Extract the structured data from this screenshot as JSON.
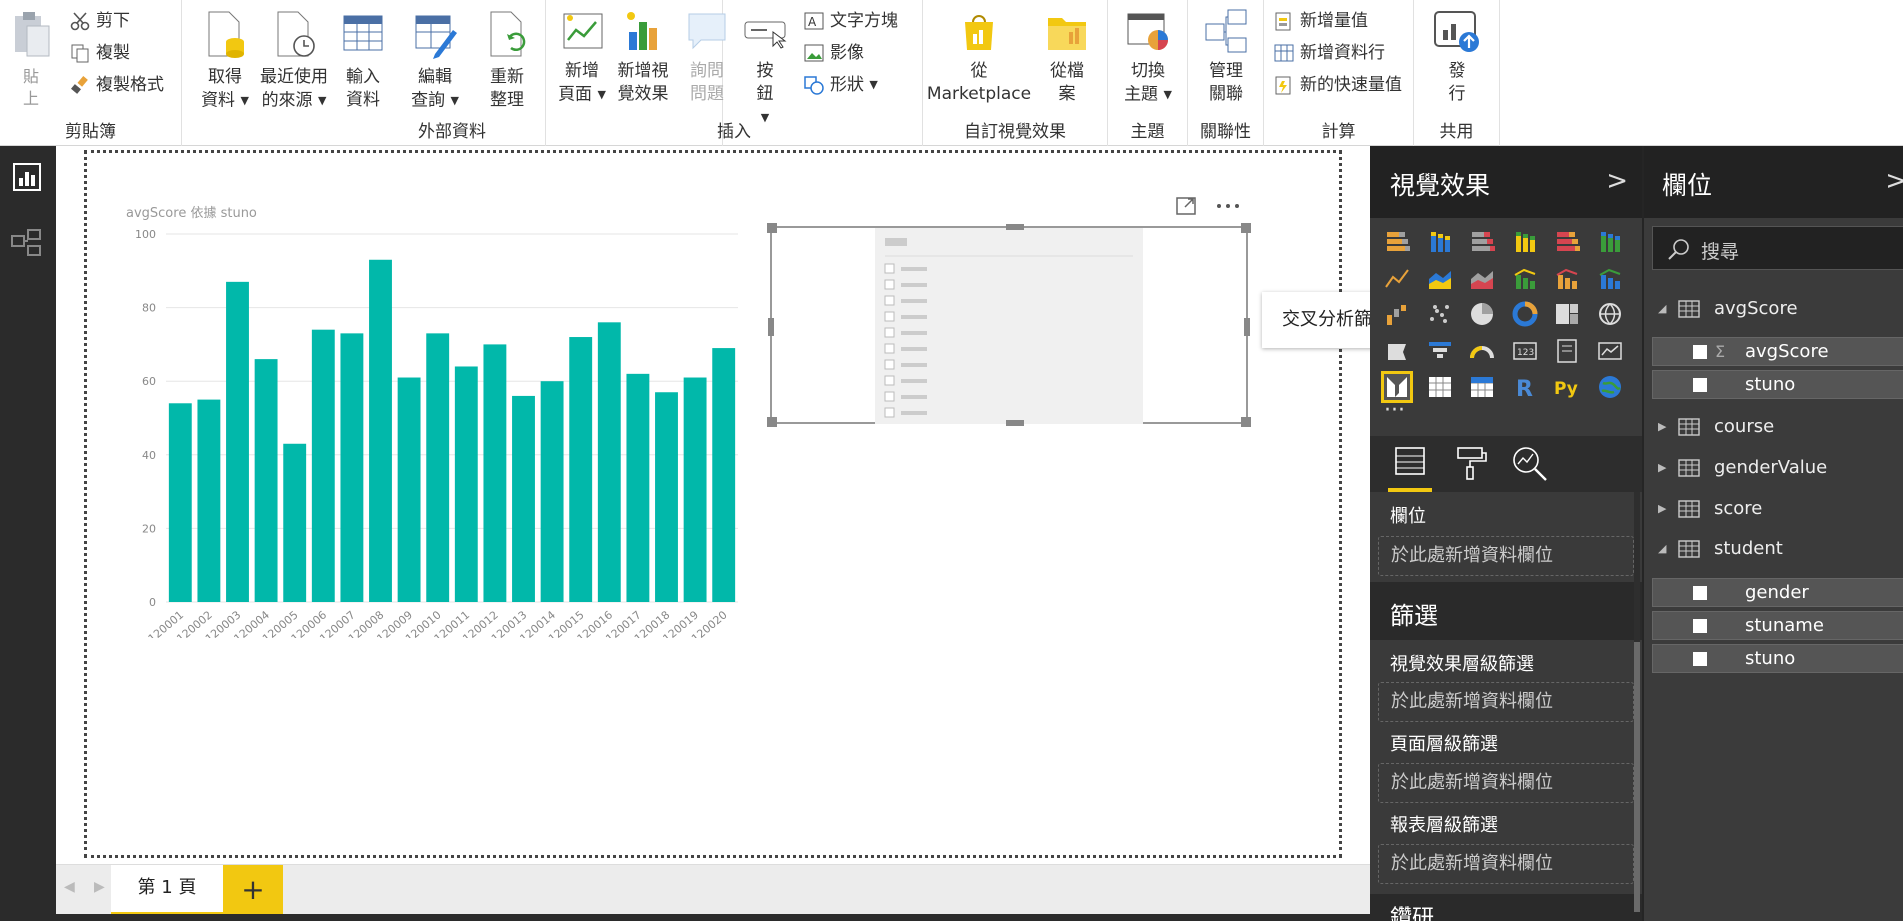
{
  "ribbon": {
    "clipboard": {
      "group": "剪貼簿",
      "paste": "貼上",
      "cut": "剪下",
      "copy": "複製",
      "format_painter": "複製格式"
    },
    "external": {
      "group": "外部資料",
      "get_data": "取得資料",
      "recent": "最近使用的來源",
      "enter": "輸入資料",
      "edit": "編輯查詢",
      "refresh": "重新整理"
    },
    "insert": {
      "group": "插入",
      "new_page": "新增頁面",
      "new_visual": "新增視覺效果",
      "qa": "詢問問題",
      "buttons": "按鈕",
      "textbox": "文字方塊",
      "image": "影像",
      "shapes": "形狀"
    },
    "custom": {
      "group": "自訂視覺效果",
      "marketplace": "從 Marketplace",
      "from_file": "從檔案"
    },
    "themes": {
      "group": "主題",
      "switch": "切換主題"
    },
    "relations": {
      "group": "關聯性",
      "manage": "管理關聯"
    },
    "calc": {
      "group": "計算",
      "new_measure": "新增量值",
      "new_column": "新增資料行",
      "quick_measure": "新的快速量值"
    },
    "share": {
      "group": "共用",
      "publish": "發行"
    }
  },
  "chart_data": {
    "type": "bar",
    "title": "avgScore 依據 stuno",
    "categories": [
      "120001",
      "120002",
      "120003",
      "120004",
      "120005",
      "120006",
      "120007",
      "120008",
      "120009",
      "120010",
      "120011",
      "120012",
      "120013",
      "120014",
      "120015",
      "120016",
      "120017",
      "120018",
      "120019",
      "120020"
    ],
    "values": [
      54,
      55,
      87,
      66,
      43,
      74,
      73,
      93,
      61,
      73,
      64,
      70,
      56,
      60,
      72,
      76,
      62,
      57,
      61,
      69
    ],
    "ylim": [
      0,
      100
    ],
    "yticks": [
      0,
      20,
      40,
      60,
      80,
      100
    ],
    "color": "#01b8aa",
    "grid": true
  },
  "tooltip": "交叉分析篩選器",
  "viz_pane": {
    "title": "視覺效果",
    "fields_label": "欄位",
    "drop_hint": "於此處新增資料欄位",
    "filters_title": "篩選",
    "visual_filter": "視覺效果層級篩選",
    "page_filter": "頁面層級篩選",
    "report_filter": "報表層級篩選",
    "drillthrough": "鑽研"
  },
  "fields_pane": {
    "title": "欄位",
    "search_placeholder": "搜尋",
    "tables": [
      "avgScore",
      "course",
      "genderValue",
      "score",
      "student"
    ],
    "avgscore_fields": [
      "avgScore",
      "stuno"
    ],
    "student_fields": [
      "gender",
      "stuname",
      "stuno"
    ]
  },
  "page_tabs": {
    "page1": "第 1 頁",
    "add": "+"
  }
}
